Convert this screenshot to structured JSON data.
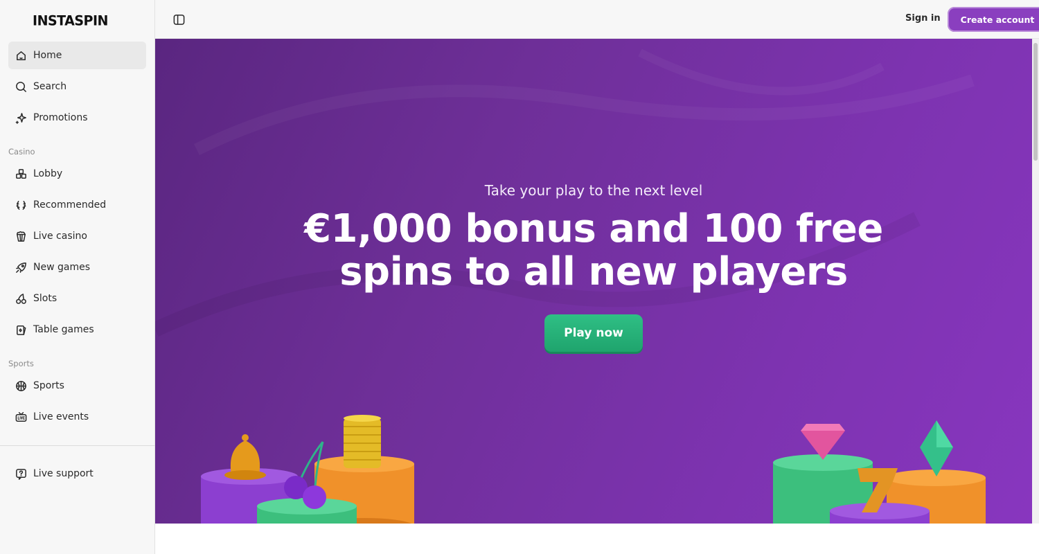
{
  "brand": {
    "logo_text": "INSTASPIN"
  },
  "sidebar": {
    "top_items": [
      {
        "label": "Home",
        "icon": "home-icon",
        "active": true
      },
      {
        "label": "Search",
        "icon": "search-icon"
      },
      {
        "label": "Promotions",
        "icon": "sparkle-icon"
      }
    ],
    "casino_label": "Casino",
    "casino_items": [
      {
        "label": "Lobby",
        "icon": "cubes-icon"
      },
      {
        "label": "Recommended",
        "icon": "laurel-icon"
      },
      {
        "label": "Live casino",
        "icon": "popcorn-icon"
      },
      {
        "label": "New games",
        "icon": "rocket-icon"
      },
      {
        "label": "Slots",
        "icon": "cherries-icon"
      },
      {
        "label": "Table games",
        "icon": "cards-icon"
      }
    ],
    "sports_label": "Sports",
    "sports_items": [
      {
        "label": "Sports",
        "icon": "basketball-icon"
      },
      {
        "label": "Live events",
        "icon": "live-tv-icon"
      }
    ],
    "support": {
      "label": "Live support",
      "icon": "help-chat-icon"
    }
  },
  "header": {
    "signin_label": "Sign in",
    "create_account_label": "Create account",
    "toggle_icon": "sidebar-toggle-icon"
  },
  "hero": {
    "subtitle": "Take your play to the next level",
    "title_line1": "€1,000 bonus and 100 free",
    "title_line2": "spins to all new players",
    "cta_label": "Play now"
  },
  "colors": {
    "accent": "#8a3fbf",
    "hero_purple": "#7d33b0",
    "cta_green": "#24b078",
    "sidebar_bg": "#f7f7f7"
  }
}
